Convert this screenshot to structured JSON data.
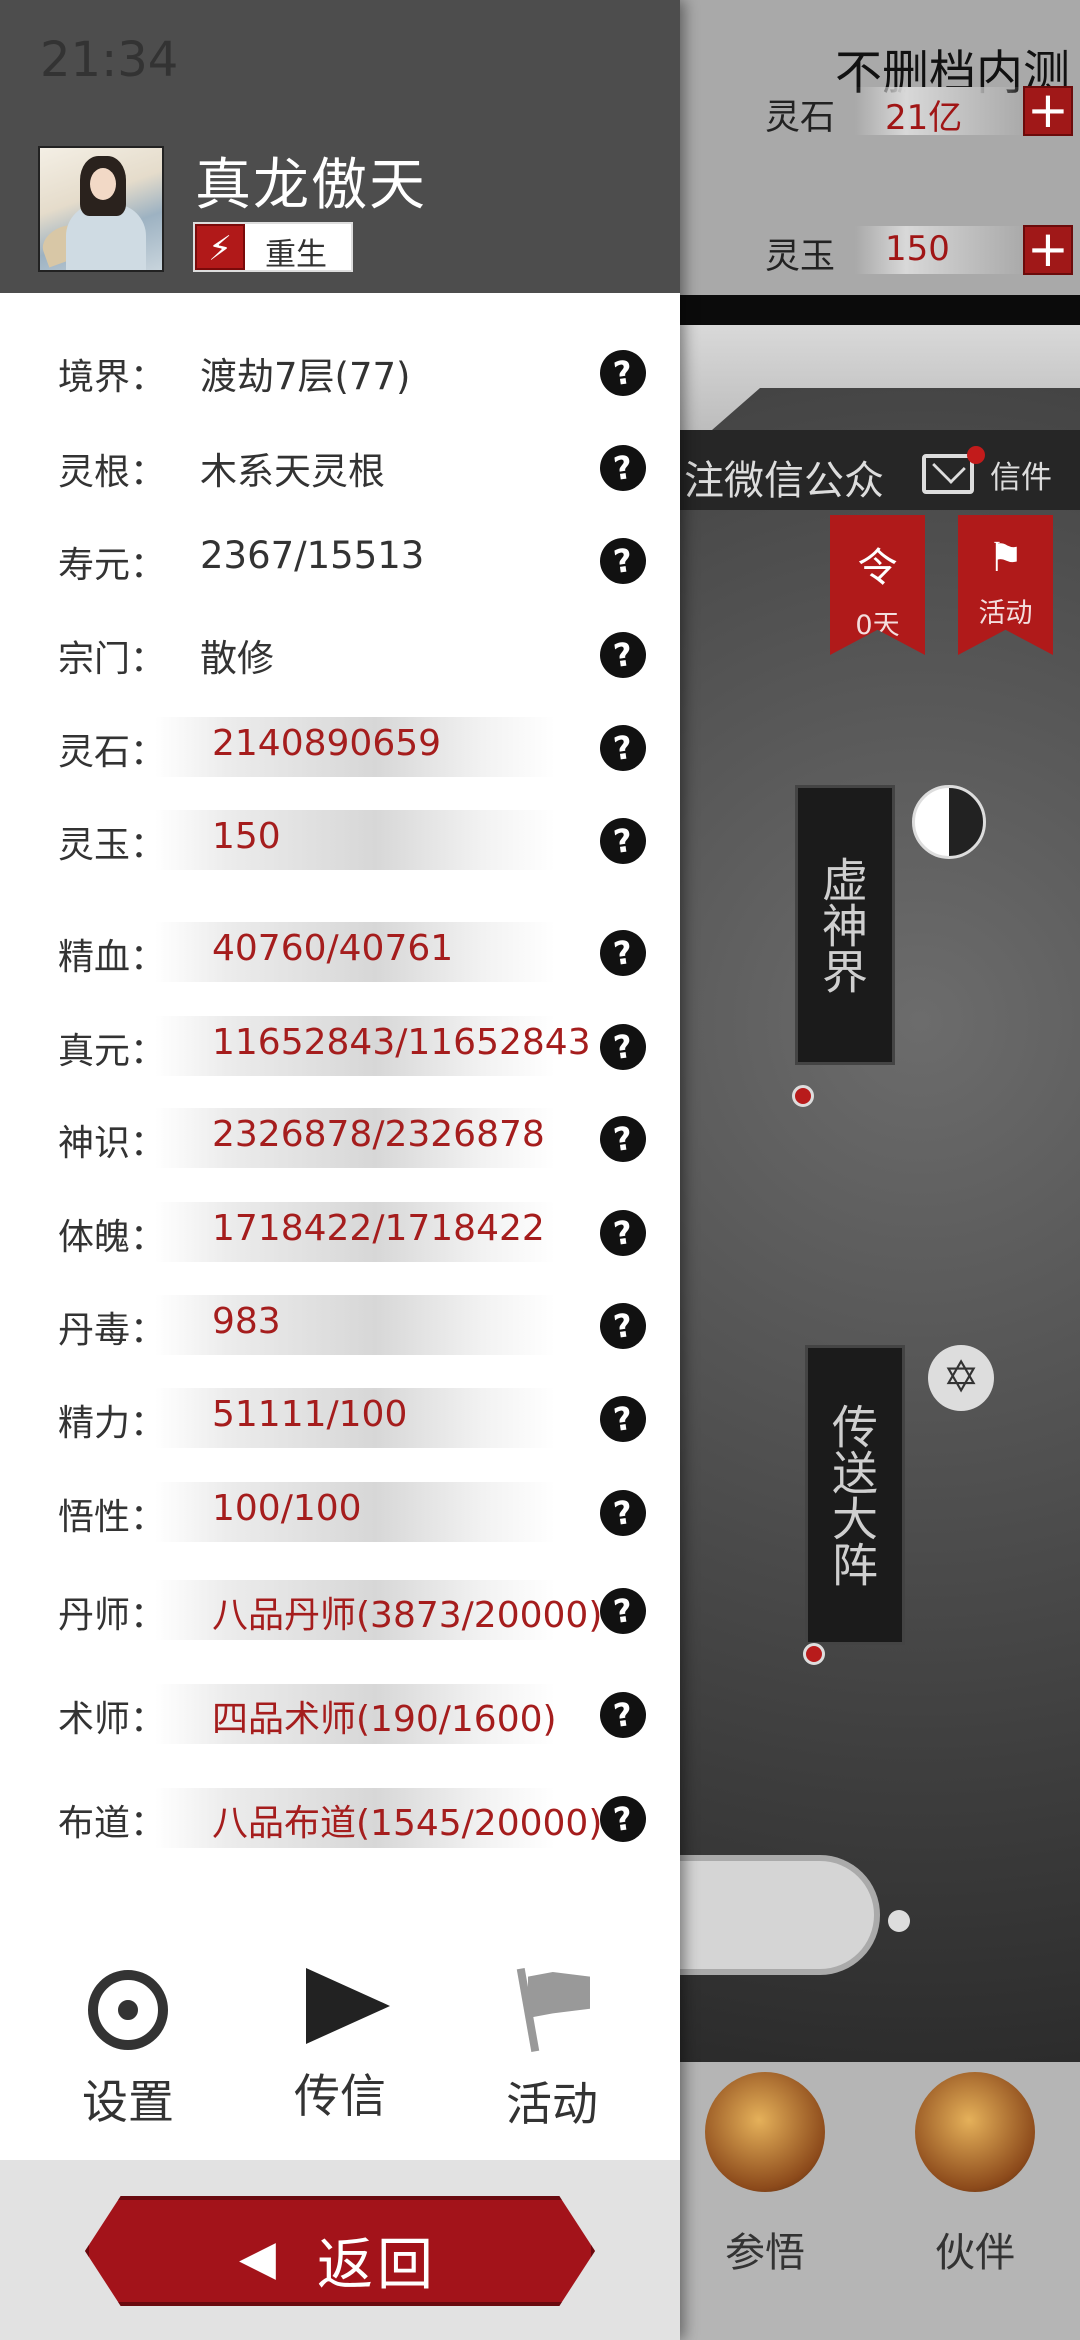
{
  "status_bar": {
    "time": "21:34"
  },
  "background": {
    "title": "不删档内测",
    "resources": [
      {
        "label": "灵石",
        "value": "21亿",
        "plus": "+"
      },
      {
        "label": "灵玉",
        "value": "150",
        "plus": "+"
      }
    ],
    "follow_text": "注微信公众",
    "mail_label": "信件",
    "banners": [
      {
        "icon": "令",
        "label": "0天"
      },
      {
        "icon": "⚑",
        "label": "活动"
      }
    ],
    "map_plaques": [
      "虚神界",
      "传送大阵"
    ],
    "map_symbols": {
      "taiji": "☯",
      "hexagram": "✡"
    },
    "bottom_nav": [
      "参悟",
      "伙伴"
    ]
  },
  "character": {
    "name": "真龙傲天",
    "badge_icon": "⚡",
    "badge_text": "重生"
  },
  "stats": [
    {
      "label": "境界：",
      "value": "渡劫7层(77)",
      "style": "plain"
    },
    {
      "label": "灵根：",
      "value": "木系天灵根",
      "style": "plain"
    },
    {
      "label": "寿元：",
      "value": "2367/15513",
      "style": "plain"
    },
    {
      "label": "宗门：",
      "value": "散修",
      "style": "plain"
    },
    {
      "label": "灵石：",
      "value": "2140890659",
      "style": "bar"
    },
    {
      "label": "灵玉：",
      "value": "150",
      "style": "bar"
    },
    {
      "label": "精血：",
      "value": "40760/40761",
      "style": "bar"
    },
    {
      "label": "真元：",
      "value": "11652843/11652843",
      "style": "bar"
    },
    {
      "label": "神识：",
      "value": "2326878/2326878",
      "style": "bar"
    },
    {
      "label": "体魄：",
      "value": "1718422/1718422",
      "style": "bar"
    },
    {
      "label": "丹毒：",
      "value": "983",
      "style": "bar"
    },
    {
      "label": "精力：",
      "value": "51111/100",
      "style": "bar"
    },
    {
      "label": "悟性：",
      "value": "100/100",
      "style": "bar"
    },
    {
      "label": "丹师：",
      "value": "八品丹师(3873/20000)",
      "style": "bar"
    },
    {
      "label": "术师：",
      "value": "四品术师(190/1600)",
      "style": "bar"
    },
    {
      "label": "布道：",
      "value": "八品布道(1545/20000)",
      "style": "bar"
    }
  ],
  "help_icon": "?",
  "actions": [
    {
      "label": "设置",
      "icon": "settings-icon"
    },
    {
      "label": "传信",
      "icon": "send-icon"
    },
    {
      "label": "活动",
      "icon": "flag-icon"
    }
  ],
  "back_button": {
    "arrow": "◀",
    "label": "返回"
  },
  "colors": {
    "accent_red": "#a3131a",
    "value_red": "#a51d1d",
    "header_gray": "#4d4d4d"
  }
}
